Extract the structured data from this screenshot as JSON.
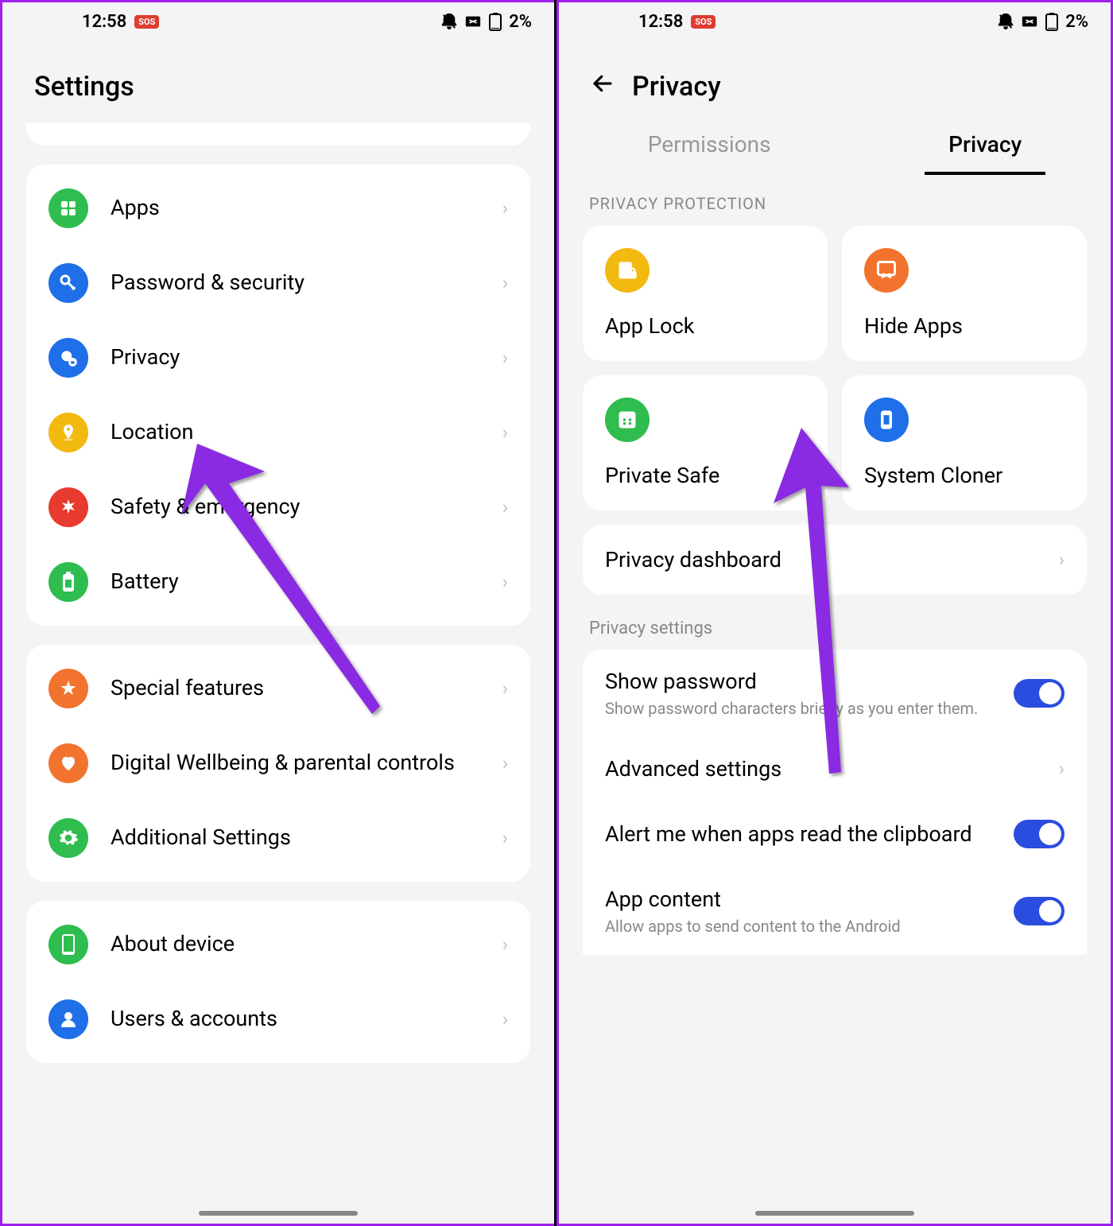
{
  "status": {
    "time": "12:58",
    "sos": "SOS",
    "battery": "2%"
  },
  "left": {
    "title": "Settings",
    "groups": [
      {
        "items": [
          {
            "label": "Apps",
            "icon": "apps",
            "color": "#2ebd4e"
          },
          {
            "label": "Password & security",
            "icon": "key",
            "color": "#1e6fe8"
          },
          {
            "label": "Privacy",
            "icon": "privacy",
            "color": "#1e6fe8"
          },
          {
            "label": "Location",
            "icon": "location",
            "color": "#f2b90f"
          },
          {
            "label": "Safety & emergency",
            "icon": "emergency",
            "color": "#e83a2e"
          },
          {
            "label": "Battery",
            "icon": "battery",
            "color": "#2ebd4e"
          }
        ]
      },
      {
        "items": [
          {
            "label": "Special features",
            "icon": "star",
            "color": "#f2732e"
          },
          {
            "label": "Digital Wellbeing & parental controls",
            "icon": "heart",
            "color": "#f2732e"
          },
          {
            "label": "Additional Settings",
            "icon": "gear",
            "color": "#2ebd4e"
          }
        ]
      },
      {
        "items": [
          {
            "label": "About device",
            "icon": "device",
            "color": "#2ebd4e"
          },
          {
            "label": "Users & accounts",
            "icon": "user",
            "color": "#1e6fe8"
          }
        ]
      }
    ]
  },
  "right": {
    "title": "Privacy",
    "tabs": {
      "permissions": "Permissions",
      "privacy": "Privacy"
    },
    "section_protection": "PRIVACY PROTECTION",
    "tiles": [
      {
        "label": "App Lock",
        "icon": "applock",
        "color": "#f2b90f"
      },
      {
        "label": "Hide Apps",
        "icon": "hide",
        "color": "#f2732e"
      },
      {
        "label": "Private Safe",
        "icon": "safe",
        "color": "#2ebd4e"
      },
      {
        "label": "System Cloner",
        "icon": "clone",
        "color": "#1e6fe8"
      }
    ],
    "dashboard": "Privacy dashboard",
    "section_settings": "Privacy settings",
    "settings": [
      {
        "title": "Show password",
        "sub": "Show password characters briefly as you enter them.",
        "toggle": true
      },
      {
        "title": "Advanced settings",
        "chev": true
      },
      {
        "title": "Alert me when apps read the clipboard",
        "toggle": true
      },
      {
        "title": "App content",
        "sub": "Allow apps to send content to the Android",
        "toggle": true
      }
    ]
  }
}
